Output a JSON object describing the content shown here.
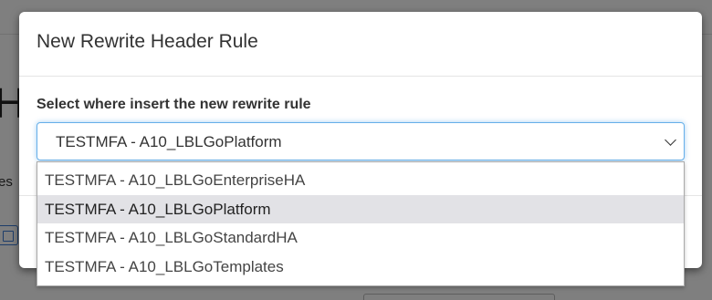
{
  "background": {
    "heading_fragment": "He",
    "left_text_fragment": "es"
  },
  "modal": {
    "title": "New Rewrite Header Rule",
    "field_label": "Select where insert the new rewrite rule",
    "select": {
      "selected_value": "TESTMFA - A10_LBLGoPlatform",
      "options": [
        "TESTMFA - A10_LBLGoEnterpriseHA",
        "TESTMFA - A10_LBLGoPlatform",
        "TESTMFA - A10_LBLGoStandardHA",
        "TESTMFA - A10_LBLGoTemplates"
      ],
      "highlighted_index": 1
    }
  },
  "colors": {
    "focus_border": "#66afe9",
    "highlight_bg": "#e2e2e6"
  }
}
